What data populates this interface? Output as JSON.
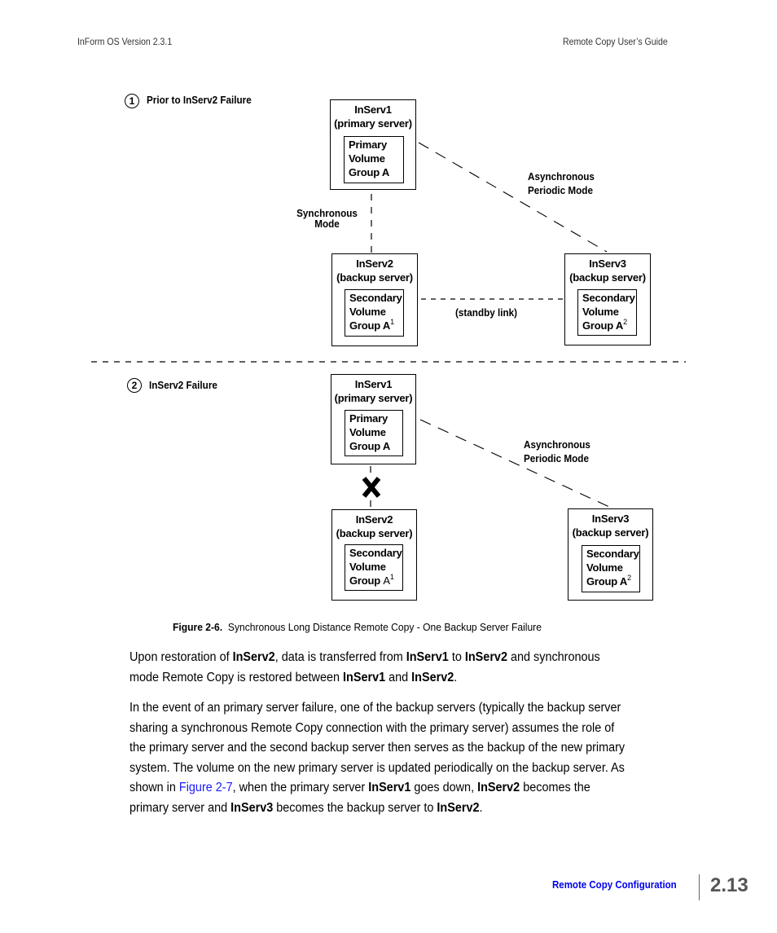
{
  "header": {
    "left": "InForm OS Version 2.3.1",
    "right": "Remote Copy User’s Guide"
  },
  "figure": {
    "panel1": {
      "step_number": "1",
      "title": "Prior to InServ2 Failure",
      "inserv1": {
        "name": "InServ1",
        "role": "(primary server)",
        "volume": [
          "Primary",
          "Volume",
          "Group A"
        ]
      },
      "inserv2": {
        "name": "InServ2",
        "role": "(backup server)",
        "volume": [
          "Secondary",
          "Volume",
          "Group A"
        ],
        "superscript": "1"
      },
      "inserv3": {
        "name": "InServ3",
        "role": "(backup server)",
        "volume": [
          "Secondary",
          "Volume",
          "Group A"
        ],
        "superscript": "2"
      },
      "sync_label": [
        "Synchronous",
        "Mode"
      ],
      "async_label": [
        "Asynchronous",
        "Periodic Mode"
      ],
      "standby_label": "(standby link)"
    },
    "panel2": {
      "step_number": "2",
      "title": "InServ2 Failure",
      "inserv1": {
        "name": "InServ1",
        "role": "(primary server)",
        "volume": [
          "Primary",
          "Volume",
          "Group A"
        ]
      },
      "inserv2": {
        "name": "InServ2",
        "role": "(backup server)",
        "volume": [
          "Secondary",
          "Volume",
          "Group"
        ],
        "volume_suffix": "A",
        "superscript": "1"
      },
      "inserv3": {
        "name": "InServ3",
        "role": "(backup server)",
        "volume": [
          "Secondary",
          "Volume",
          "Group A"
        ],
        "superscript": "2"
      },
      "async_label": [
        "Asynchronous",
        "Periodic Mode"
      ],
      "failure_icon": "x-mark-icon"
    },
    "caption_label": "Figure 2-6.",
    "caption_text": "Synchronous Long Distance Remote Copy - One Backup Server Failure"
  },
  "paragraph1": {
    "t1": "Upon restoration of ",
    "b1": "InServ2",
    "t2": ", data is transferred from ",
    "b2": "InServ1",
    "t3": " to ",
    "b3": "InServ2",
    "t4": " and synchronous",
    "t5": "mode Remote Copy is restored between ",
    "b4": "InServ1",
    "t6": " and ",
    "b5": "InServ2",
    "t7": "."
  },
  "paragraph2": {
    "l1": "In the event of an primary server failure, one of the backup servers (typically the backup server",
    "l2": "sharing a synchronous Remote Copy connection with the primary server) assumes the role of",
    "l3": "the primary server and the second backup server then serves as the backup of the new primary",
    "l4": "system. The volume on the new primary server is updated periodically on the backup server. As",
    "l5a": "shown in ",
    "link": "Figure 2-7",
    "l5b": ", when the primary server ",
    "b1": "InServ1",
    "l5c": " goes down, ",
    "b2": "InServ2",
    "l5d": " becomes the",
    "l6a": "primary server and ",
    "b3": "InServ3",
    "l6b": " becomes the backup server to ",
    "b4": "InServ2",
    "l6c": "."
  },
  "footer": {
    "section_link": "Remote Copy Configuration",
    "page_number": "2.13"
  },
  "colors": {
    "link": "#1a1aff",
    "footer_link": "#0000ee",
    "page_number": "#555555"
  }
}
